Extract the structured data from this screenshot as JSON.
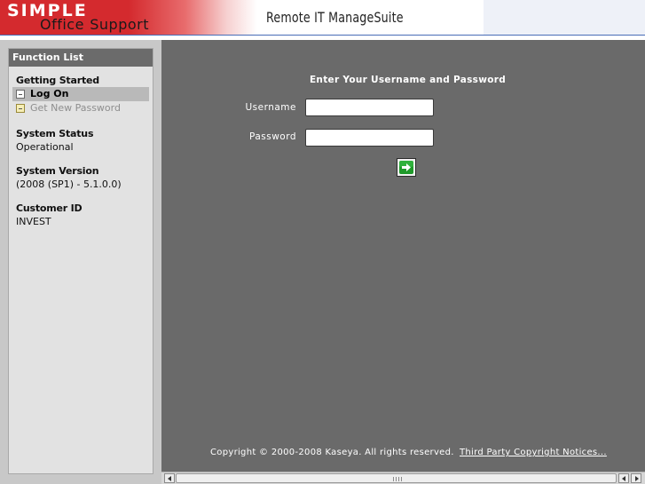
{
  "header": {
    "logo_simple": "SIMPLE",
    "logo_office": "Office",
    "logo_separator": "-",
    "logo_support": "Support",
    "title": "Remote IT ManageSuite",
    "colors": {
      "brand_red": "#d42a2e",
      "accent_blue": "#2f57a8"
    }
  },
  "sidebar": {
    "header": "Function List",
    "getting_started": {
      "title": "Getting Started",
      "items": [
        {
          "label": "Log On",
          "icon": "page-icon",
          "state": "selected"
        },
        {
          "label": "Get New Password",
          "icon": "page-icon",
          "state": "disabled"
        }
      ]
    },
    "system_status": {
      "title": "System Status",
      "value": "Operational"
    },
    "system_version": {
      "title": "System Version",
      "value": "(2008 (SP1) - 5.1.0.0)"
    },
    "customer_id": {
      "title": "Customer ID",
      "value": "INVEST"
    }
  },
  "login": {
    "title": "Enter Your Username and Password",
    "username_label": "Username",
    "username_value": "",
    "password_label": "Password",
    "password_value": "",
    "submit_icon": "green-arrow-right-icon"
  },
  "footer": {
    "copyright": "Copyright © 2000-2008 Kaseya. All rights reserved.",
    "link": "Third Party Copyright Notices..."
  },
  "colors": {
    "main_bg": "#6a6a6a",
    "sidebar_bg": "#e2e2e2",
    "submit_green": "#1f9a2a"
  }
}
